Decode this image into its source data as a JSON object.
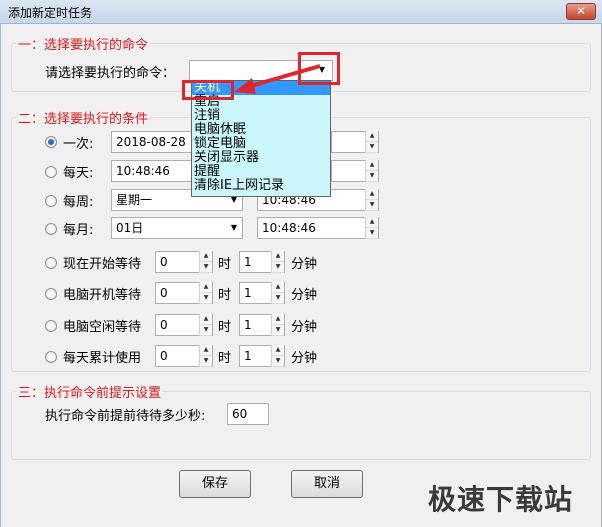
{
  "window": {
    "title": "添加新定时任务",
    "close": "✕"
  },
  "section1": {
    "legend": "一：选择要执行的命令",
    "label": "请选择要执行的命令：",
    "options": [
      "关机",
      "重启",
      "注销",
      "电脑休眠",
      "锁定电脑",
      "关闭显示器",
      "提醒",
      "清除IE上网记录"
    ]
  },
  "section2": {
    "legend": "二：选择要执行的条件",
    "once": {
      "label": "一次:",
      "date": "2018-08-28"
    },
    "daily": {
      "label": "每天:",
      "time": "10:48:46"
    },
    "weekly": {
      "label": "每周:",
      "day": "星期一",
      "time": "10:48:46"
    },
    "monthly": {
      "label": "每月:",
      "day": "01日",
      "time": "10:48:46"
    },
    "waits": [
      {
        "label": "现在开始等待",
        "hours": "0",
        "minutes": "1"
      },
      {
        "label": "电脑开机等待",
        "hours": "0",
        "minutes": "1"
      },
      {
        "label": "电脑空闲等待",
        "hours": "0",
        "minutes": "1"
      },
      {
        "label": "每天累计使用",
        "hours": "0",
        "minutes": "1"
      }
    ],
    "hour_unit": "时",
    "minute_unit": "分钟"
  },
  "section3": {
    "legend": "三：执行命令前提示设置",
    "label": "执行命令前提前待待多少秒:",
    "seconds": "60"
  },
  "buttons": {
    "save": "保存",
    "cancel": "取消"
  },
  "watermark": "极速下载站",
  "colors": {
    "accent_red": "#e0252b",
    "dropdown_bg": "#c9f7fc",
    "selection": "#3399ff"
  }
}
